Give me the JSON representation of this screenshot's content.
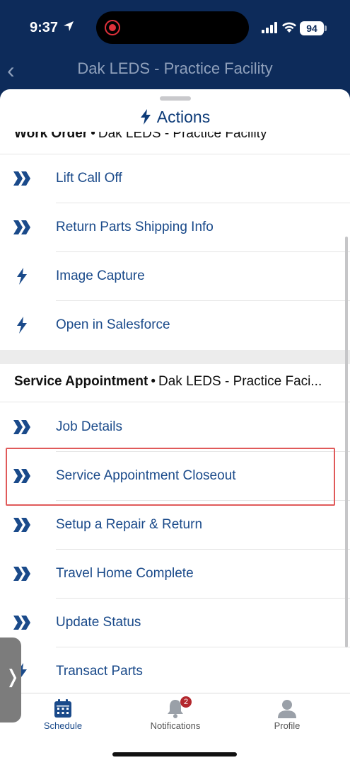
{
  "status_bar": {
    "time": "9:37",
    "battery": "94"
  },
  "nav": {
    "title": "Dak LEDS - Practice Facility"
  },
  "sheet": {
    "title": "Actions"
  },
  "work_order": {
    "name": "Work Order",
    "separator": "•",
    "subtitle": "Dak LEDS - Practice Facility",
    "items": [
      {
        "label": "Lift Call Off",
        "icon": "double-chevron-icon"
      },
      {
        "label": "Return Parts Shipping Info",
        "icon": "double-chevron-icon"
      },
      {
        "label": "Image Capture",
        "icon": "lightning-icon"
      },
      {
        "label": "Open in Salesforce",
        "icon": "lightning-icon"
      }
    ]
  },
  "service_appointment": {
    "name": "Service Appointment",
    "separator": "•",
    "subtitle": "Dak LEDS - Practice Faci...",
    "items": [
      {
        "label": "Job Details",
        "icon": "double-chevron-icon"
      },
      {
        "label": "Service Appointment Closeout",
        "icon": "double-chevron-icon"
      },
      {
        "label": "Setup a Repair & Return",
        "icon": "double-chevron-icon"
      },
      {
        "label": "Travel Home Complete",
        "icon": "double-chevron-icon"
      },
      {
        "label": "Update Status",
        "icon": "double-chevron-icon"
      },
      {
        "label": "Transact Parts",
        "icon": "lightning-icon"
      }
    ]
  },
  "tabs": [
    {
      "label": "Schedule",
      "icon": "calendar-icon"
    },
    {
      "label": "Notifications",
      "icon": "bell-icon",
      "badge": "2"
    },
    {
      "label": "Profile",
      "icon": "person-icon"
    }
  ],
  "colors": {
    "accent": "#1a4a8a",
    "nav_bg": "#0d2b5a",
    "highlight": "#e05a5a",
    "badge": "#b3272d"
  }
}
